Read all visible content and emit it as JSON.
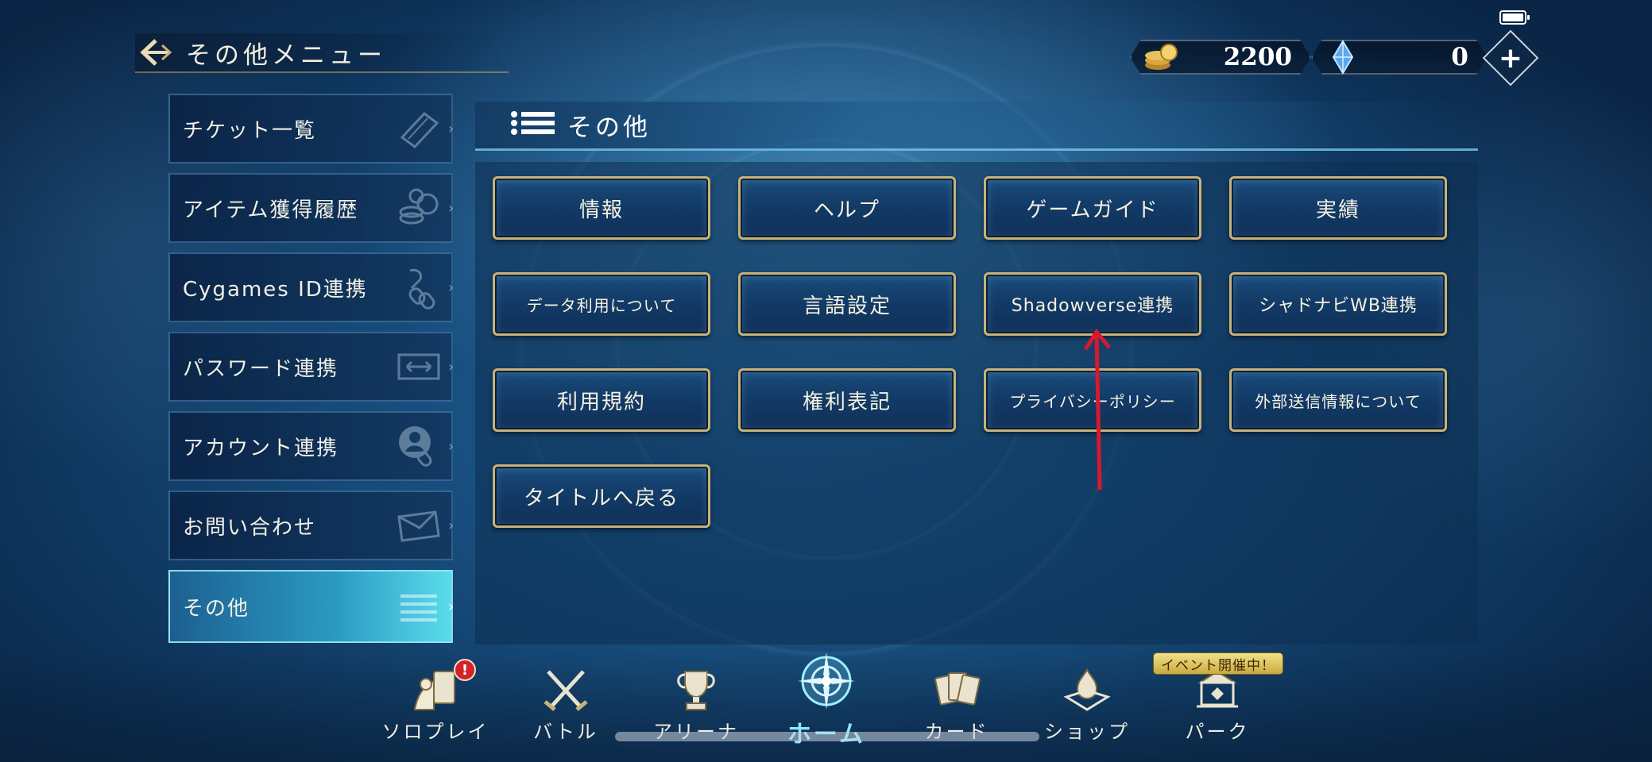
{
  "header": {
    "title": "その他メニュー"
  },
  "currency": {
    "gold": "2200",
    "crystal": "0"
  },
  "sidebar": {
    "items": [
      {
        "label": "チケット一覧",
        "icon": "ticket-icon"
      },
      {
        "label": "アイテム獲得履歴",
        "icon": "coins-icon"
      },
      {
        "label": "Cygames ID連携",
        "icon": "chain-link-icon"
      },
      {
        "label": "パスワード連携",
        "icon": "transfer-icon"
      },
      {
        "label": "アカウント連携",
        "icon": "account-link-icon"
      },
      {
        "label": "お問い合わせ",
        "icon": "mail-icon"
      },
      {
        "label": "その他",
        "icon": "menu-lines-icon",
        "active": true
      }
    ]
  },
  "section": {
    "title": "その他"
  },
  "buttons": [
    {
      "label": "情報"
    },
    {
      "label": "ヘルプ"
    },
    {
      "label": "ゲームガイド"
    },
    {
      "label": "実績"
    },
    {
      "label": "データ利用について"
    },
    {
      "label": "言語設定"
    },
    {
      "label": "Shadowverse連携"
    },
    {
      "label": "シャドナビWB連携"
    },
    {
      "label": "利用規約"
    },
    {
      "label": "権利表記"
    },
    {
      "label": "プライバシーポリシー"
    },
    {
      "label": "外部送信情報について"
    },
    {
      "label": "タイトルへ戻る"
    }
  ],
  "bottom_nav": {
    "items": [
      {
        "label": "ソロプレイ",
        "icon": "solo-play-icon",
        "alert": "!"
      },
      {
        "label": "バトル",
        "icon": "crossed-swords-icon"
      },
      {
        "label": "アリーナ",
        "icon": "trophy-icon"
      },
      {
        "label": "ホーム",
        "icon": "home-emblem-icon",
        "active": true
      },
      {
        "label": "カード",
        "icon": "cards-icon"
      },
      {
        "label": "ショップ",
        "icon": "shop-icon"
      },
      {
        "label": "パーク",
        "icon": "park-icon"
      }
    ],
    "event_tag": "イベント開催中！"
  },
  "colors": {
    "accent_gold": "#c8b27a",
    "annotation_arrow": "#d8182f",
    "active_cyan": "#8fe6ff"
  }
}
